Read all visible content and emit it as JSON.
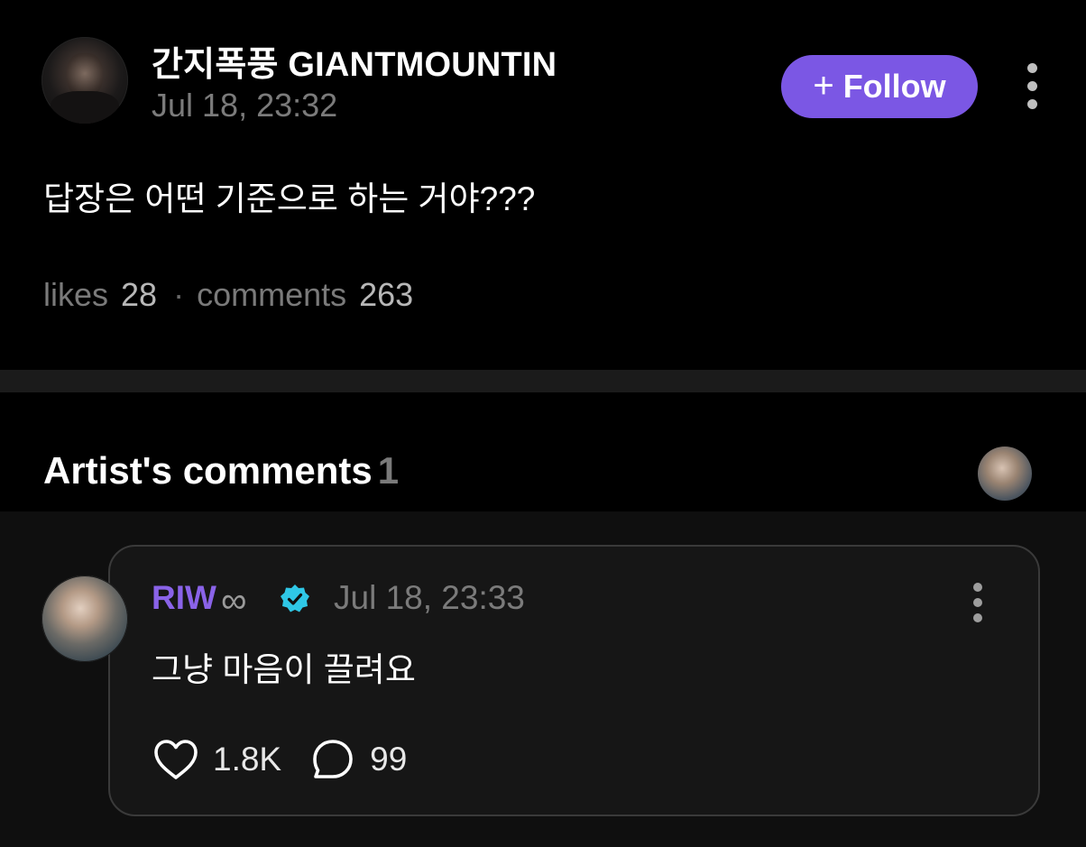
{
  "post": {
    "author_name": "간지폭풍 GIANTMOUNTIN",
    "timestamp": "Jul 18, 23:32",
    "follow_label": "Follow",
    "follow_plus": "+",
    "body": "답장은 어떤 기준으로 하는 거야???",
    "likes_label": "likes",
    "likes_count": "28",
    "separator": "·",
    "comments_label": "comments",
    "comments_count": "263"
  },
  "artist_comments": {
    "title": "Artist's comments",
    "count": "1"
  },
  "comment": {
    "author_name": "RIW",
    "author_badge": "∞",
    "timestamp": "Jul 18, 23:33",
    "text": "그냥 마음이 끌려요",
    "like_count": "1.8K",
    "reply_count": "99"
  },
  "icons": {
    "post_menu": "more-vertical-icon",
    "comment_menu": "more-vertical-icon",
    "verified": "verified-badge-icon",
    "like": "heart-icon",
    "reply": "speech-bubble-icon"
  },
  "colors": {
    "accent": "#7b57e4",
    "artist_name": "#8a63e8",
    "verified": "#2fc7e6",
    "background": "#000000",
    "muted_text": "#7b7b7b"
  }
}
